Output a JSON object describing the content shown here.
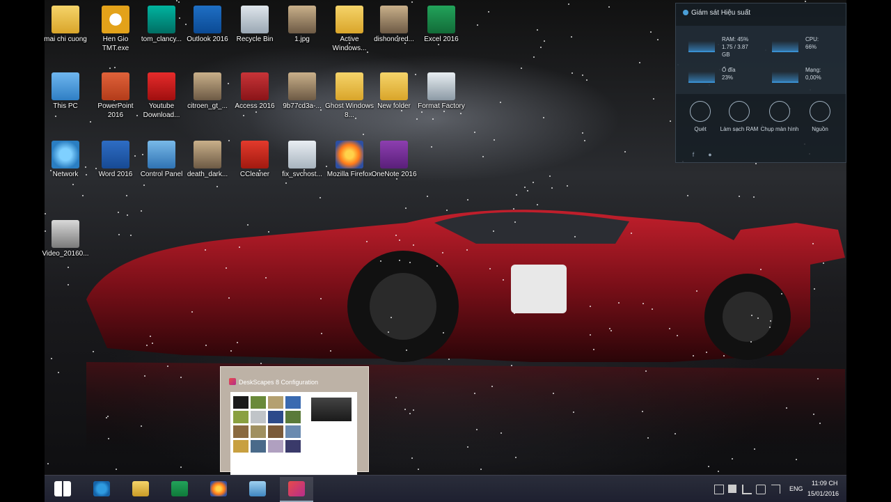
{
  "desktop_icons": [
    {
      "label": "mai chi cuong",
      "icon": "folder-icon"
    },
    {
      "label": "Hen Gio TMT.exe",
      "icon": "alarm-clock-icon"
    },
    {
      "label": "tom_clancy...",
      "icon": "game-logo-icon"
    },
    {
      "label": "Outlook 2016",
      "icon": "outlook-icon"
    },
    {
      "label": "Recycle Bin",
      "icon": "recycle-bin-icon"
    },
    {
      "label": "1.jpg",
      "icon": "image-file-icon"
    },
    {
      "label": "Active Windows...",
      "icon": "folder-icon"
    },
    {
      "label": "dishonored...",
      "icon": "image-file-icon"
    },
    {
      "label": "Excel 2016",
      "icon": "excel-icon"
    },
    {
      "label": "This PC",
      "icon": "computer-icon"
    },
    {
      "label": "PowerPoint 2016",
      "icon": "powerpoint-icon"
    },
    {
      "label": "Youtube Download...",
      "icon": "youtube-downloader-icon"
    },
    {
      "label": "citroen_gt_...",
      "icon": "image-file-icon"
    },
    {
      "label": "Access 2016",
      "icon": "access-icon"
    },
    {
      "label": "9b77cd3a-...",
      "icon": "image-file-icon"
    },
    {
      "label": "Ghost Windows 8...",
      "icon": "folder-icon"
    },
    {
      "label": "New folder",
      "icon": "folder-icon"
    },
    {
      "label": "Format Factory",
      "icon": "format-factory-icon"
    },
    {
      "label": "Network",
      "icon": "network-icon"
    },
    {
      "label": "Word 2016",
      "icon": "word-icon"
    },
    {
      "label": "Control Panel",
      "icon": "control-panel-icon"
    },
    {
      "label": "death_dark...",
      "icon": "image-file-icon"
    },
    {
      "label": "CCleaner",
      "icon": "ccleaner-icon"
    },
    {
      "label": "fix_svchost...",
      "icon": "settings-file-icon"
    },
    {
      "label": "Mozilla Firefox",
      "icon": "firefox-icon"
    },
    {
      "label": "OneNote 2016",
      "icon": "onenote-icon"
    },
    {
      "label": "Video_20160...",
      "icon": "video-file-icon"
    }
  ],
  "widget": {
    "title": "Giám sát Hiệu suất",
    "ram_label": "RAM: 45%",
    "ram_detail": "1.75 / 3.87 GB",
    "cpu_label": "CPU:",
    "cpu_value": "66%",
    "disk_label": "Ổ đĩa",
    "disk_value": "23%",
    "net_label": "Mạng:",
    "net_value": "0,00%",
    "buttons": [
      {
        "label": "Quét",
        "icon": "scan-icon"
      },
      {
        "label": "Làm sạch RAM",
        "icon": "clean-ram-icon"
      },
      {
        "label": "Chụp màn hình",
        "icon": "screenshot-icon"
      },
      {
        "label": "Nguồn",
        "icon": "power-icon"
      }
    ]
  },
  "thumbnail": {
    "title": "DeskScapes 8 Configuration"
  },
  "taskbar": {
    "items": [
      {
        "name": "start",
        "icon": "windows-logo-icon"
      },
      {
        "name": "ie",
        "icon": "internet-explorer-icon"
      },
      {
        "name": "explorer",
        "icon": "file-explorer-icon"
      },
      {
        "name": "store",
        "icon": "store-icon"
      },
      {
        "name": "firefox",
        "icon": "firefox-icon"
      },
      {
        "name": "app5",
        "icon": "window-icon"
      },
      {
        "name": "deskscapes",
        "icon": "deskscapes-icon"
      }
    ],
    "tray": {
      "lang": "ENG",
      "time": "11:09 CH",
      "date": "15/01/2016"
    }
  },
  "colors": {
    "accent": "#3a8fd0",
    "taskbar": "#1e2030"
  }
}
